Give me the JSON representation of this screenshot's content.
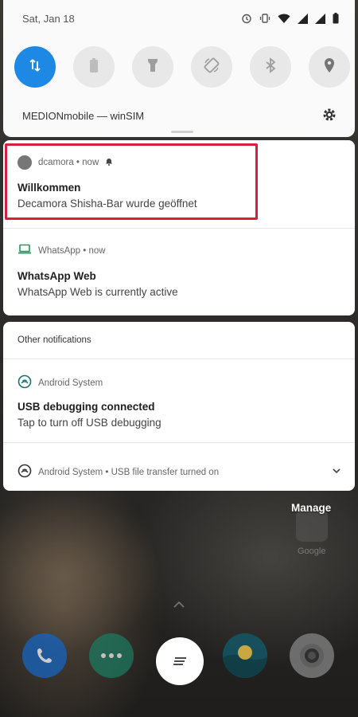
{
  "status_bar": {
    "date": "Sat, Jan 18"
  },
  "quick_settings": {
    "tiles": [
      {
        "name": "mobile-data-tile",
        "icon": "data-arrows-icon",
        "active": true
      },
      {
        "name": "battery-saver-tile",
        "icon": "battery-icon",
        "active": false
      },
      {
        "name": "flashlight-tile",
        "icon": "flashlight-icon",
        "active": false
      },
      {
        "name": "auto-rotate-tile",
        "icon": "rotate-icon",
        "active": false
      },
      {
        "name": "bluetooth-tile",
        "icon": "bluetooth-icon",
        "active": false
      },
      {
        "name": "location-tile",
        "icon": "location-icon",
        "active": false
      }
    ],
    "carrier": "MEDIONmobile — winSIM"
  },
  "notifications": {
    "dcamora": {
      "app_line": "dcamora • now",
      "title": "Willkommen",
      "body": "Decamora Shisha-Bar wurde geöffnet"
    },
    "whatsapp": {
      "app_line": "WhatsApp • now",
      "title": "WhatsApp Web",
      "body": "WhatsApp Web is currently active"
    },
    "other_label": "Other notifications",
    "android_usb": {
      "app_line": "Android System",
      "title": "USB debugging connected",
      "body": "Tap to turn off USB debugging"
    },
    "android_file": {
      "app_line": "Android System • USB file transfer turned on"
    }
  },
  "home": {
    "manage": "Manage",
    "google": "Google"
  },
  "colors": {
    "accent": "#1e88e5",
    "highlight": "#d81f3a"
  }
}
